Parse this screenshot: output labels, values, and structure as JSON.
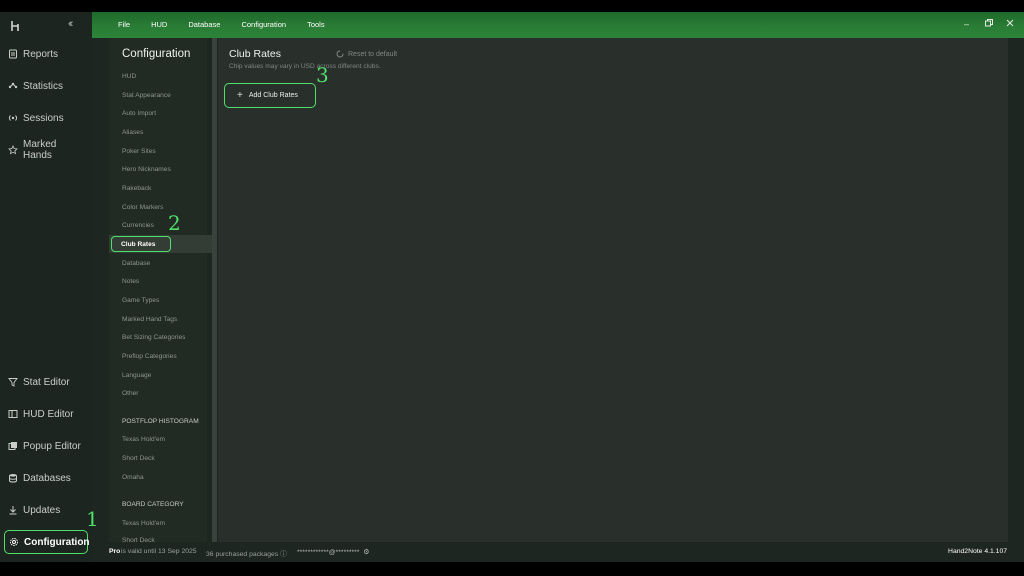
{
  "nav": {
    "items": [
      {
        "label": "Reports",
        "icon": "reports-icon"
      },
      {
        "label": "Statistics",
        "icon": "statistics-icon"
      },
      {
        "label": "Sessions",
        "icon": "sessions-icon"
      },
      {
        "label": "Marked Hands",
        "icon": "star-icon"
      },
      {
        "label": "Stat Editor",
        "icon": "filter-icon"
      },
      {
        "label": "HUD Editor",
        "icon": "hud-editor-icon"
      },
      {
        "label": "Popup Editor",
        "icon": "popup-editor-icon"
      },
      {
        "label": "Databases",
        "icon": "database-icon"
      },
      {
        "label": "Updates",
        "icon": "download-icon"
      },
      {
        "label": "Configuration",
        "icon": "gear-icon"
      }
    ],
    "collapse_glyph": "‹‹"
  },
  "menu": [
    "File",
    "HUD",
    "Database",
    "Configuration",
    "Tools"
  ],
  "config": {
    "title": "Configuration",
    "items": [
      "HUD",
      "Stat Appearance",
      "Auto Import",
      "Aliases",
      "Poker Sites",
      "Hero Nicknames",
      "Rakeback",
      "Color Markers",
      "Currencies"
    ],
    "selected": "Club Rates",
    "items_after": [
      "Database",
      "Notes",
      "Game Types",
      "Marked Hand Tags",
      "Bet Sizing Categories",
      "Preflop Categories",
      "Language",
      "Other"
    ],
    "section1": "POSTFLOP HISTOGRAM",
    "section1_items": [
      "Texas Hold'em",
      "Short Deck",
      "Omaha"
    ],
    "section2": "BOARD CATEGORY",
    "section2_items": [
      "Texas Hold'em",
      "Short Deck"
    ]
  },
  "content": {
    "title": "Club Rates",
    "reset_label": "Reset to default",
    "subtitle": "Chip values may vary in USD across different clubs.",
    "add_button": "Add Club Rates"
  },
  "status": {
    "plan": "Pro",
    "valid_text": "is valid until 13 Sep 2025",
    "packages": "36 purchased packages",
    "account": "************@*********",
    "version": "Hand2Note 4.1.107"
  },
  "steps": [
    "1",
    "2",
    "3"
  ],
  "colors": {
    "accent": "#4fe06a",
    "band": "#2a7d36"
  }
}
